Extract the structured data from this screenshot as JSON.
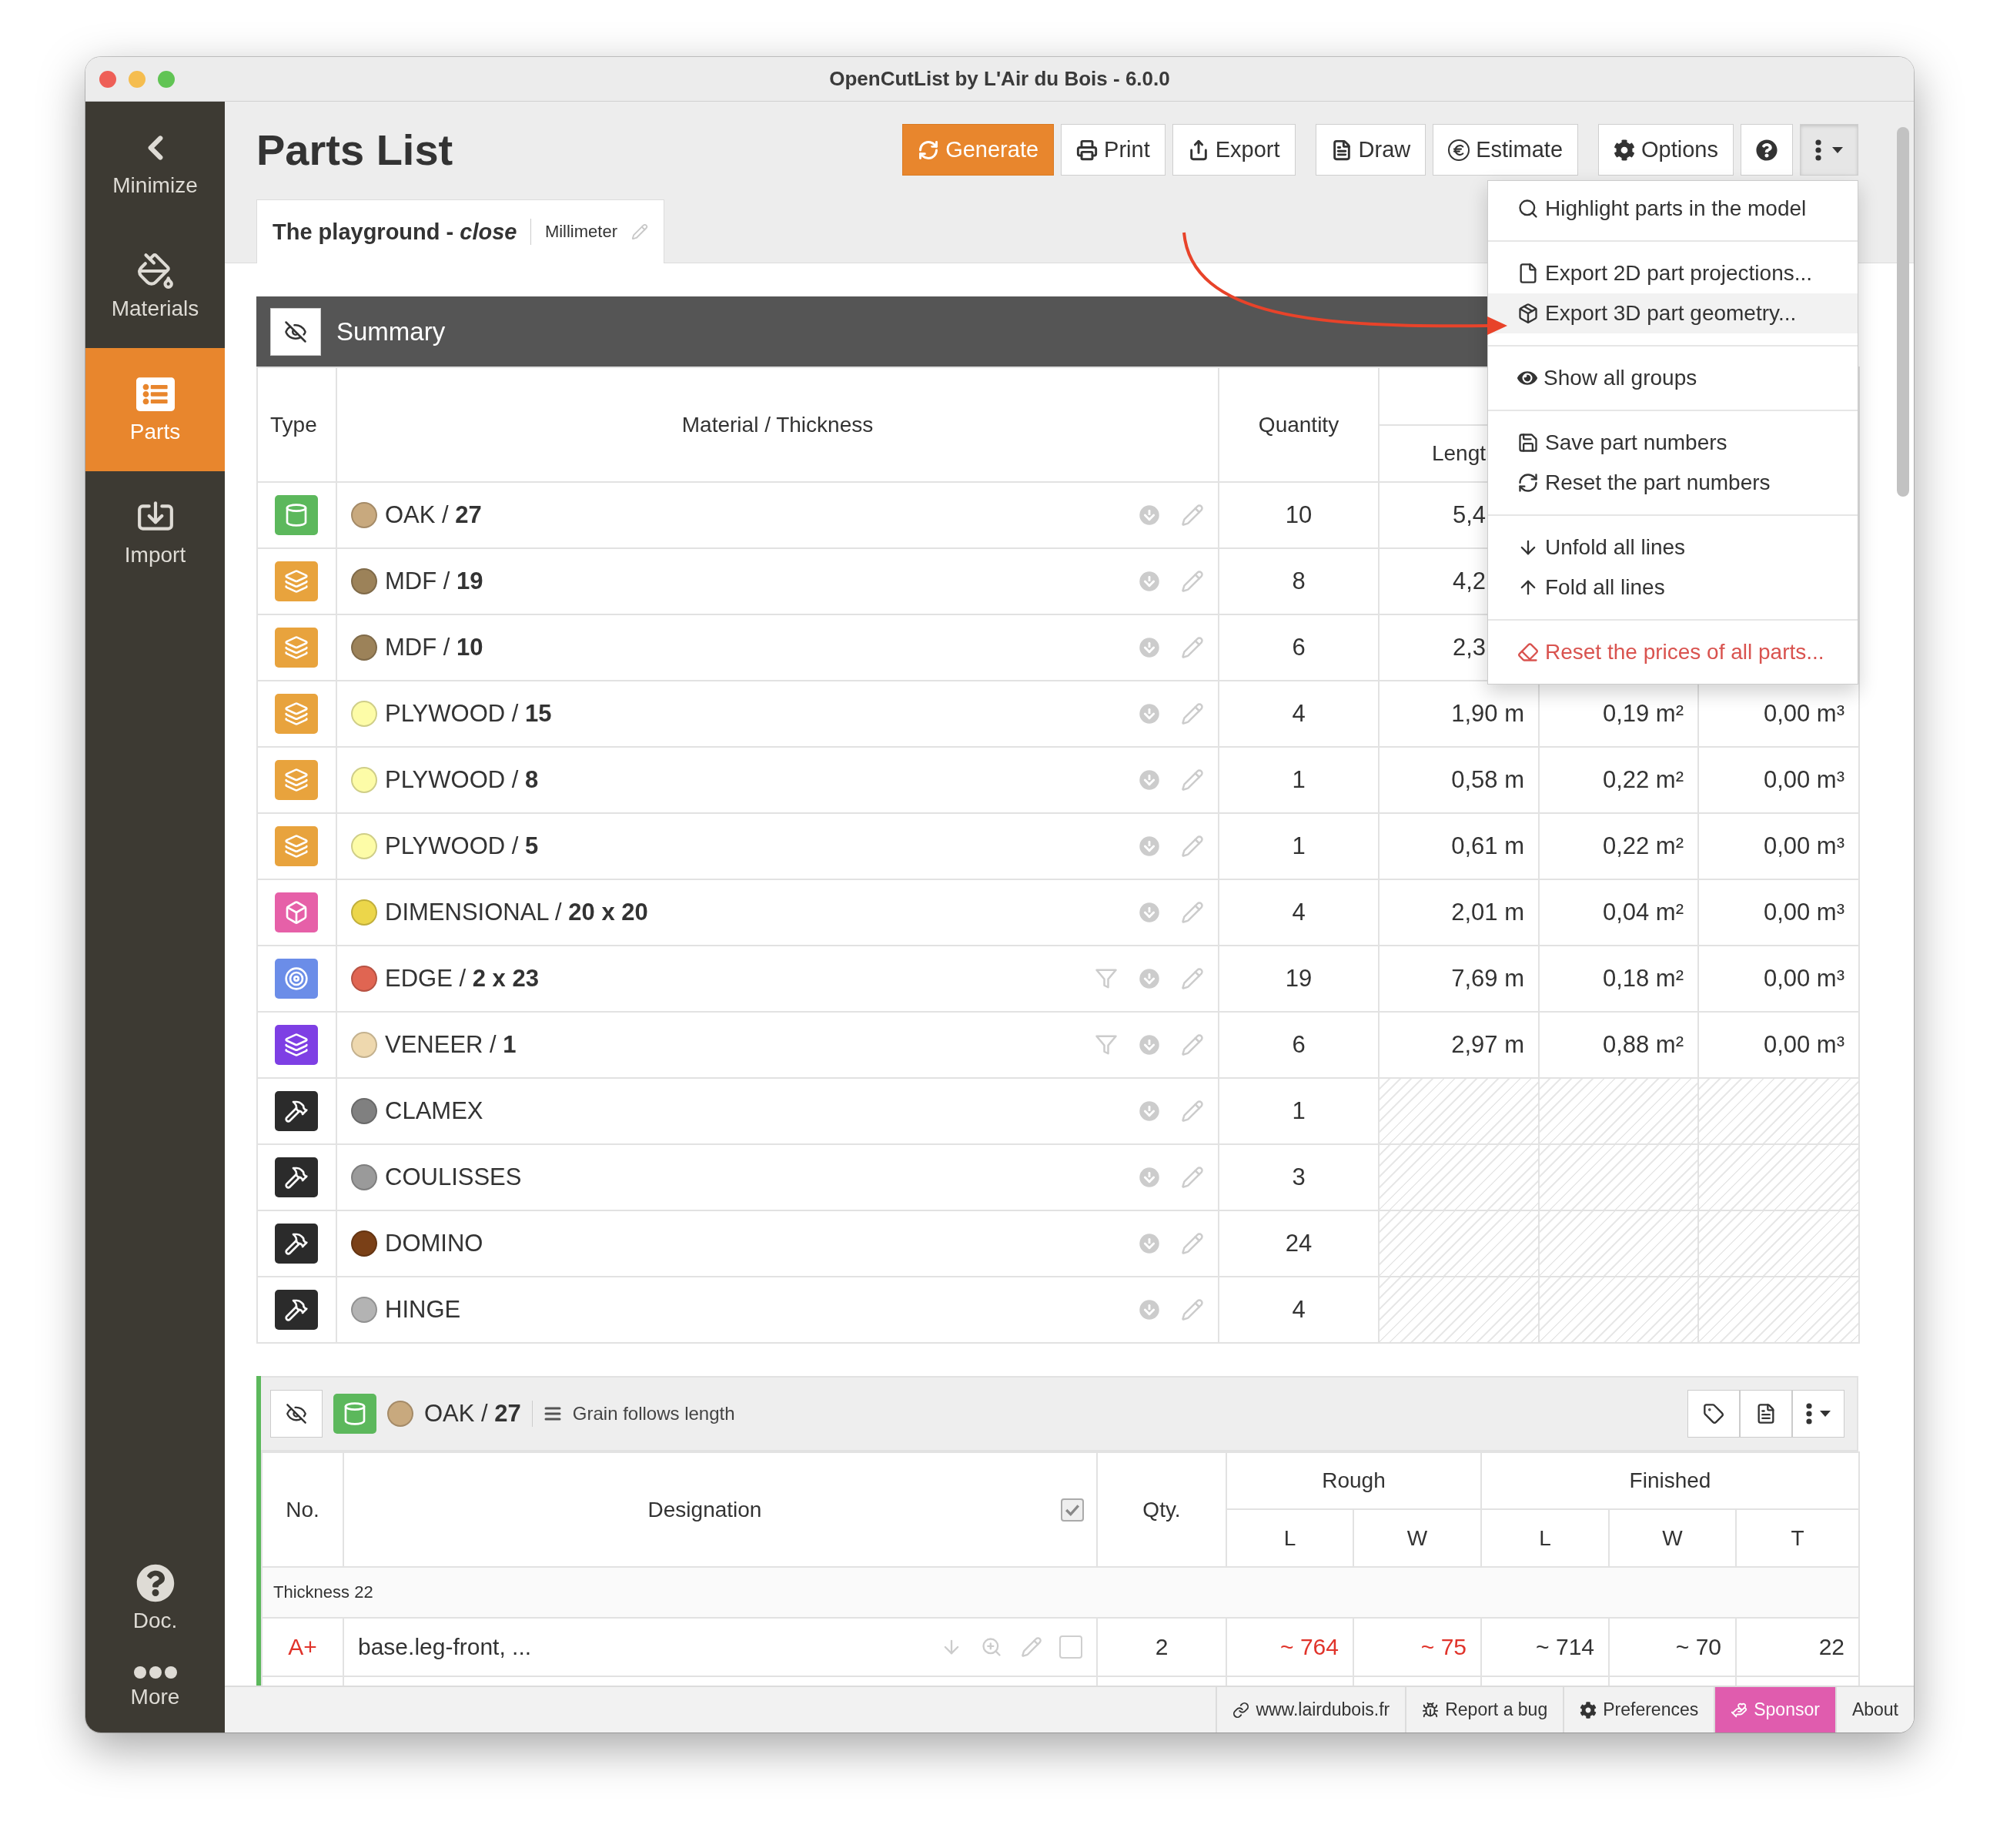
{
  "window": {
    "title": "OpenCutList by L'Air du Bois - 6.0.0"
  },
  "sidebar": {
    "items": [
      {
        "label": "Minimize",
        "selected": false
      },
      {
        "label": "Materials",
        "selected": false
      },
      {
        "label": "Parts",
        "selected": true
      },
      {
        "label": "Import",
        "selected": false
      }
    ],
    "bottom_items": [
      {
        "label": "Doc."
      },
      {
        "label": "More"
      }
    ]
  },
  "header": {
    "title": "Parts List",
    "button_groups": [
      [
        {
          "label": "Generate",
          "kind": "primary"
        },
        {
          "label": "Print",
          "kind": "default"
        },
        {
          "label": "Export",
          "kind": "default"
        }
      ],
      [
        {
          "label": "Draw",
          "kind": "default"
        },
        {
          "label": "Estimate",
          "kind": "default"
        }
      ],
      [
        {
          "label": "Options",
          "kind": "default"
        },
        {
          "kind": "icon"
        },
        {
          "kind": "menu",
          "expanded": true
        }
      ]
    ]
  },
  "tab": {
    "title": "The playground - *close*",
    "unit": "Millimeter"
  },
  "summary": {
    "title": "Summary",
    "columns": [
      "Type",
      "Material / Thickness",
      "Quantity"
    ],
    "subcolumns": [
      "Lengt"
    ],
    "rows": [
      {
        "kind": "solid_wood",
        "material": "OAK / **27**",
        "color": "#c8a97e",
        "filter": false,
        "quantity": "10",
        "length": "5,4",
        "cut": true
      },
      {
        "kind": "sheet_good",
        "material": "MDF / **19**",
        "color": "#9c8259",
        "filter": false,
        "quantity": "8",
        "length": "4,2",
        "cut": true
      },
      {
        "kind": "sheet_good",
        "material": "MDF / **10**",
        "color": "#9c8259",
        "filter": false,
        "quantity": "6",
        "length": "2,3",
        "cut": true
      },
      {
        "kind": "sheet_good",
        "material": "PLYWOOD / **15**",
        "color": "#fdfca7",
        "filter": false,
        "quantity": "4",
        "length": "1,90 m",
        "area": "0,19 m²",
        "volume": "0,00 m³",
        "cut": false
      },
      {
        "kind": "sheet_good",
        "material": "PLYWOOD / **8**",
        "color": "#fdfca7",
        "filter": false,
        "quantity": "1",
        "length": "0,58 m",
        "area": "0,22 m²",
        "volume": "0,00 m³",
        "cut": false
      },
      {
        "kind": "sheet_good",
        "material": "PLYWOOD / **5**",
        "color": "#fdfca7",
        "filter": false,
        "quantity": "1",
        "length": "0,61 m",
        "area": "0,22 m²",
        "volume": "0,00 m³",
        "cut": false
      },
      {
        "kind": "dimensional",
        "material": "DIMENSIONAL / **20 x 20**",
        "color": "#ecd64a",
        "filter": false,
        "quantity": "4",
        "length": "2,01 m",
        "area": "0,04 m²",
        "volume": "0,00 m³",
        "cut": false
      },
      {
        "kind": "edge",
        "material": "EDGE / **2 x 23**",
        "color": "#e06552",
        "filter": true,
        "quantity": "19",
        "length": "7,69 m",
        "area": "0,18 m²",
        "volume": "0,00 m³",
        "cut": false
      },
      {
        "kind": "veneer",
        "material": "VENEER / **1**",
        "color": "#eed8ae",
        "filter": true,
        "quantity": "6",
        "length": "2,97 m",
        "area": "0,88 m²",
        "volume": "0,00 m³",
        "cut": false
      },
      {
        "kind": "hardware",
        "material": "CLAMEX",
        "color": "#808080",
        "filter": false,
        "quantity": "1"
      },
      {
        "kind": "hardware",
        "material": "COULISSES",
        "color": "#9a9a9a",
        "filter": false,
        "quantity": "3"
      },
      {
        "kind": "hardware",
        "material": "DOMINO",
        "color": "#7a4017",
        "filter": false,
        "quantity": "24"
      },
      {
        "kind": "hardware",
        "material": "HINGE",
        "color": "#b3b3b3",
        "filter": false,
        "quantity": "4"
      }
    ]
  },
  "menu": {
    "groups": [
      [
        {
          "label": "Highlight parts in the model",
          "kind": "normal",
          "highlighted": false
        }
      ],
      [
        {
          "label": "Export 2D part projections...",
          "kind": "normal",
          "highlighted": false
        },
        {
          "label": "Export 3D part geometry...",
          "kind": "normal",
          "highlighted": true
        }
      ],
      [
        {
          "label": "Show all groups",
          "kind": "normal",
          "highlighted": false
        }
      ],
      [
        {
          "label": "Save part numbers",
          "kind": "normal",
          "highlighted": false
        },
        {
          "label": "Reset the part numbers",
          "kind": "normal",
          "highlighted": false
        }
      ],
      [
        {
          "label": "Unfold all lines",
          "kind": "normal",
          "highlighted": false
        },
        {
          "label": "Fold all lines",
          "kind": "normal",
          "highlighted": false
        }
      ],
      [
        {
          "label": "Reset the prices of all parts...",
          "kind": "danger",
          "highlighted": false
        }
      ]
    ]
  },
  "group": {
    "kind": "solid_wood",
    "material": "OAK / **27**",
    "color": "#c8a97e",
    "grain": "Grain follows length",
    "columns": [
      "No.",
      "Designation",
      "Qty."
    ],
    "group_columns": [
      "Rough",
      "Finished"
    ],
    "subcolumns": [
      "L",
      "W",
      "L",
      "W",
      "T"
    ],
    "designation_checked": true,
    "section": "Thickness 22",
    "rows": [
      {
        "number": "A+",
        "name": "base.leg-front, ...",
        "qty": "2",
        "rough": [
          "~ 764",
          "~ 75"
        ],
        "finished": [
          "~ 714",
          "~ 70",
          "22"
        ],
        "checked": false
      }
    ]
  },
  "status_bar": {
    "items": [
      {
        "label": "www.lairdubois.fr",
        "kind": "link"
      },
      {
        "label": "Report a bug",
        "kind": "default"
      },
      {
        "label": "Preferences",
        "kind": "default"
      },
      {
        "label": "Sponsor",
        "kind": "sponsor"
      },
      {
        "label": "About",
        "kind": "plain"
      }
    ]
  }
}
